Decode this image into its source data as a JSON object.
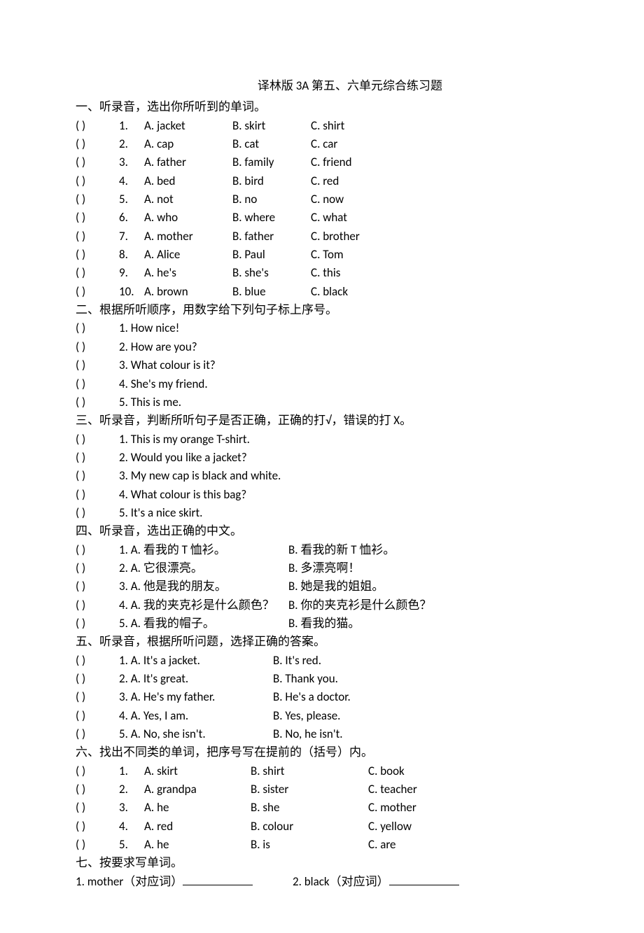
{
  "title": "译林版 3A 第五、六单元综合练习题",
  "sections": {
    "s1": {
      "header": "一、听录音，选出你所听到的单词。",
      "rows": [
        {
          "p": "(        )",
          "n": "1.",
          "a": "A. jacket",
          "b": "B. skirt",
          "c": "C. shirt"
        },
        {
          "p": "(        )",
          "n": "2.",
          "a": "A. cap",
          "b": "B. cat",
          "c": "C. car"
        },
        {
          "p": "(        )",
          "n": "3.",
          "a": "A. father",
          "b": "B. family",
          "c": "C. friend"
        },
        {
          "p": "(        )",
          "n": "4.",
          "a": "A. bed",
          "b": "B. bird",
          "c": "C. red"
        },
        {
          "p": "(        )",
          "n": "5.",
          "a": "A. not",
          "b": "B. no",
          "c": "C. now"
        },
        {
          "p": "(        )",
          "n": "6.",
          "a": "A. who",
          "b": "B. where",
          "c": "C. what"
        },
        {
          "p": "(        )",
          "n": "7.",
          "a": "A. mother",
          "b": "B. father",
          "c": "C. brother"
        },
        {
          "p": "(        )",
          "n": "8.",
          "a": "A. Alice",
          "b": "B. Paul",
          "c": "C. Tom"
        },
        {
          "p": "(        )",
          "n": "9.",
          "a": "A. he's",
          "b": "B. she's",
          "c": "C. this"
        },
        {
          "p": "(        )",
          "n": "10.",
          "a": "A. brown",
          "b": "B. blue",
          "c": "C. black"
        }
      ]
    },
    "s2": {
      "header": "二、根据所听顺序，用数字给下列句子标上序号。",
      "rows": [
        {
          "p": "(        )",
          "t": "1. How nice!"
        },
        {
          "p": "(        )",
          "t": "2. How are you?"
        },
        {
          "p": "(        )",
          "t": "3. What colour is it?"
        },
        {
          "p": "(        )",
          "t": "4. She's my friend."
        },
        {
          "p": "(        )",
          "t": "5. This is me."
        }
      ]
    },
    "s3": {
      "header": "三、听录音，判断所听句子是否正确，正确的打√，错误的打 X。",
      "rows": [
        {
          "p": "(        )",
          "t": "1. This is my orange T-shirt."
        },
        {
          "p": "(        )",
          "t": "2. Would you like a jacket?"
        },
        {
          "p": "(        )",
          "t": "3. My new cap is black and white."
        },
        {
          "p": "(        )",
          "t": "4. What colour is this bag?"
        },
        {
          "p": "(        )",
          "t": "5. It's a nice skirt."
        }
      ]
    },
    "s4": {
      "header": "四、听录音，选出正确的中文。",
      "rows": [
        {
          "p": "(        )",
          "a": "1. A.  看我的 T 恤衫。",
          "b": "B.  看我的新 T 恤衫。"
        },
        {
          "p": "(        )",
          "a": "2. A.  它很漂亮。",
          "b": "B.  多漂亮啊！"
        },
        {
          "p": "(        )",
          "a": "3. A.  他是我的朋友。",
          "b": "B.  她是我的姐姐。"
        },
        {
          "p": "(        )",
          "a": "4. A.  我的夹克衫是什么颜色？",
          "b": "B.  你的夹克衫是什么颜色？"
        },
        {
          "p": "(        )",
          "a": "5. A.  看我的帽子。",
          "b": "B.  看我的猫。"
        }
      ]
    },
    "s5": {
      "header": "五、听录音，根据所听问题，选择正确的答案。",
      "rows": [
        {
          "p": "(        )",
          "a": "1. A. It's a jacket.",
          "b": "B. It's red."
        },
        {
          "p": "(        )",
          "a": "2. A. It's great.",
          "b": "B. Thank you."
        },
        {
          "p": "(        )",
          "a": "3. A. He's my father.",
          "b": "B. He's a doctor."
        },
        {
          "p": "(        )",
          "a": "4. A. Yes, I am.",
          "b": "B. Yes, please."
        },
        {
          "p": "(        )",
          "a": "5. A. No, she isn't.",
          "b": "B. No, he isn't."
        }
      ]
    },
    "s6": {
      "header": "六、找出不同类的单词，把序号写在提前的（括号）内。",
      "rows": [
        {
          "p": "(        )",
          "n": "1.",
          "a": "A. skirt",
          "b": "B. shirt",
          "c": "C. book"
        },
        {
          "p": "(        )",
          "n": "2.",
          "a": "A. grandpa",
          "b": "B. sister",
          "c": "C. teacher"
        },
        {
          "p": "(        )",
          "n": "3.",
          "a": "A. he",
          "b": "B. she",
          "c": "C. mother"
        },
        {
          "p": "(        )",
          "n": "4.",
          "a": "A. red",
          "b": "B. colour",
          "c": "C. yellow"
        },
        {
          "p": "(        )",
          "n": "5.",
          "a": "A. he",
          "b": "B. is",
          "c": "C. are"
        }
      ]
    },
    "s7": {
      "header": "七、按要求写单词。",
      "q1_pre": "1. mother（对应词）",
      "q2_pre": "2. black（对应词）"
    }
  }
}
